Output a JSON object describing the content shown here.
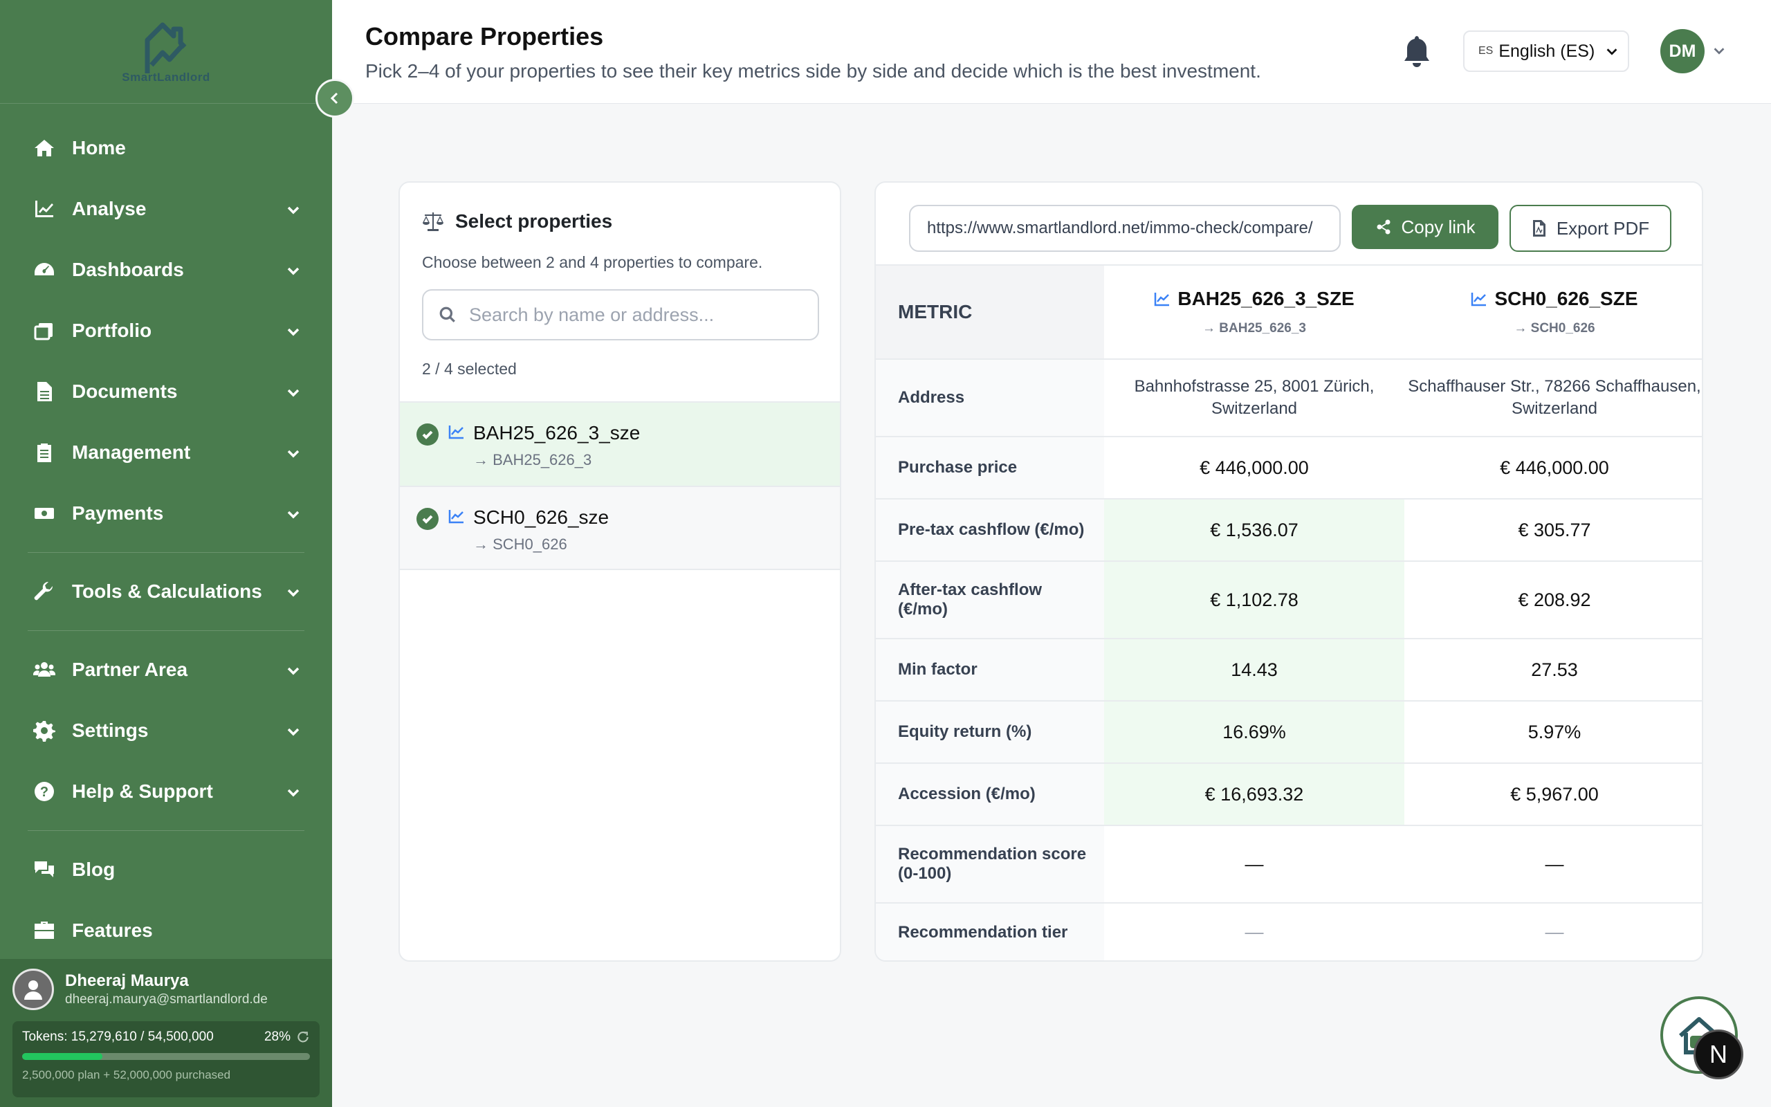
{
  "brand": {
    "name": "SmartLandlord"
  },
  "sidebar": {
    "items": [
      {
        "label": "Home",
        "icon": "home-icon",
        "expandable": false
      },
      {
        "label": "Analyse",
        "icon": "chart-line-icon",
        "expandable": true
      },
      {
        "label": "Dashboards",
        "icon": "gauge-icon",
        "expandable": true
      },
      {
        "label": "Portfolio",
        "icon": "portfolio-icon",
        "expandable": true
      },
      {
        "label": "Documents",
        "icon": "document-icon",
        "expandable": true
      },
      {
        "label": "Management",
        "icon": "clipboard-icon",
        "expandable": true
      },
      {
        "label": "Payments",
        "icon": "money-icon",
        "expandable": true
      },
      {
        "label": "Tools & Calculations",
        "icon": "wrench-icon",
        "expandable": true
      },
      {
        "label": "Partner Area",
        "icon": "users-icon",
        "expandable": true
      },
      {
        "label": "Settings",
        "icon": "gear-icon",
        "expandable": true
      },
      {
        "label": "Help & Support",
        "icon": "question-icon",
        "expandable": true
      },
      {
        "label": "Blog",
        "icon": "comments-icon",
        "expandable": false
      },
      {
        "label": "Features",
        "icon": "briefcase-icon",
        "expandable": false
      }
    ],
    "user": {
      "name": "Dheeraj Maurya",
      "email": "dheeraj.maurya@smartlandlord.de",
      "tokens_label": "Tokens: 15,279,610 / 54,500,000",
      "tokens_pct": "28%",
      "tokens_fraction": 0.28,
      "tokens_note": "2,500,000 plan + 52,000,000 purchased"
    }
  },
  "header": {
    "title": "Compare Properties",
    "subtitle": "Pick 2–4 of your properties to see their key metrics side by side and decide which is the best investment.",
    "language_code": "ES",
    "language": "English (ES)",
    "avatar_initials": "DM"
  },
  "select_panel": {
    "title": "Select properties",
    "description": "Choose between 2 and 4 properties to compare.",
    "search_placeholder": "Search by name or address...",
    "selected_count": "2 / 4 selected",
    "properties": [
      {
        "name": "BAH25_626_3_sze",
        "sub": "→ BAH25_626_3"
      },
      {
        "name": "SCH0_626_sze",
        "sub": "→ SCH0_626"
      }
    ]
  },
  "compare_panel": {
    "share_url": "https://www.smartlandlord.net/immo-check/compare/",
    "copy_label": "Copy link",
    "export_label": "Export PDF",
    "metric_header": "METRIC",
    "columns": [
      {
        "name": "BAH25_626_3_SZE",
        "sub": "→ BAH25_626_3"
      },
      {
        "name": "SCH0_626_SZE",
        "sub": "→ SCH0_626"
      }
    ],
    "rows": [
      {
        "metric": "Address",
        "values": [
          "Bahnhofstrasse 25, 8001 Zürich, Switzerland",
          "Schaffhauser Str., 78266 Schaffhausen, Switzerland"
        ]
      },
      {
        "metric": "Purchase price",
        "values": [
          "€ 446,000.00",
          "€ 446,000.00"
        ]
      },
      {
        "metric": "Pre-tax cashflow (€/mo)",
        "values": [
          "€ 1,536.07",
          "€ 305.77"
        ]
      },
      {
        "metric": "After-tax cashflow (€/mo)",
        "values": [
          "€ 1,102.78",
          "€ 208.92"
        ]
      },
      {
        "metric": "Min factor",
        "values": [
          "14.43",
          "27.53"
        ]
      },
      {
        "metric": "Equity return (%)",
        "values": [
          "16.69%",
          "5.97%"
        ]
      },
      {
        "metric": "Accession (€/mo)",
        "values": [
          "€ 16,693.32",
          "€ 5,967.00"
        ]
      },
      {
        "metric": "Recommendation score (0-100)",
        "values": [
          "—",
          "—"
        ]
      },
      {
        "metric": "Recommendation tier",
        "values": [
          "—",
          "—"
        ]
      }
    ]
  },
  "floating": {
    "badge_letter": "N"
  },
  "colors": {
    "sidebar": "#4a7c4e",
    "accent": "#4a7c4e",
    "best_cell": "#effaf1",
    "chart_icon": "#3b82f6"
  }
}
